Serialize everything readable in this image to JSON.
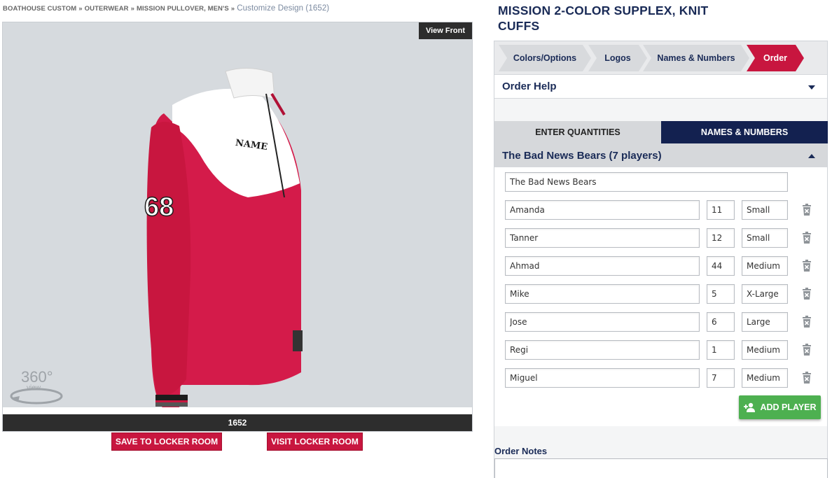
{
  "breadcrumb": {
    "items": [
      "BOATHOUSE CUSTOM",
      "OUTERWEAR",
      "MISSION PULLOVER, MEN'S"
    ],
    "separator": "»",
    "current": "Customize Design (1652)"
  },
  "viewer": {
    "view_front_label": "View Front",
    "design_number": "1652",
    "rotate_label": "360°",
    "rotate_sub": "view",
    "jacket_name_text": "NAME",
    "jacket_sleeve_number": "68"
  },
  "actions": {
    "save_label": "SAVE TO LOCKER ROOM",
    "visit_label": "VISIT LOCKER ROOM"
  },
  "product": {
    "title": "MISSION 2-COLOR SUPPLEX, KNIT CUFFS"
  },
  "steps": [
    {
      "label": "Colors/Options",
      "active": false
    },
    {
      "label": "Logos",
      "active": false
    },
    {
      "label": "Names & Numbers",
      "active": false
    },
    {
      "label": "Order",
      "active": true
    }
  ],
  "order_help": {
    "label": "Order Help"
  },
  "tabs": {
    "enter_quantities": "ENTER QUANTITIES",
    "names_numbers": "NAMES & NUMBERS"
  },
  "team": {
    "header": "The Bad News Bears (7 players)",
    "name_value": "The Bad News Bears",
    "players": [
      {
        "name": "Amanda",
        "number": "11",
        "size": "Small"
      },
      {
        "name": "Tanner",
        "number": "12",
        "size": "Small"
      },
      {
        "name": "Ahmad",
        "number": "44",
        "size": "Medium"
      },
      {
        "name": "Mike",
        "number": "5",
        "size": "X-Large"
      },
      {
        "name": "Jose",
        "number": "6",
        "size": "Large"
      },
      {
        "name": "Regi",
        "number": "1",
        "size": "Medium"
      },
      {
        "name": "Miguel",
        "number": "7",
        "size": "Medium"
      }
    ]
  },
  "add_player_label": "ADD PLAYER",
  "order_notes_label": "Order Notes",
  "colors": {
    "brand_red": "#c8163f",
    "navy": "#1a2b57",
    "dark_navy": "#132150",
    "green": "#4db050"
  }
}
